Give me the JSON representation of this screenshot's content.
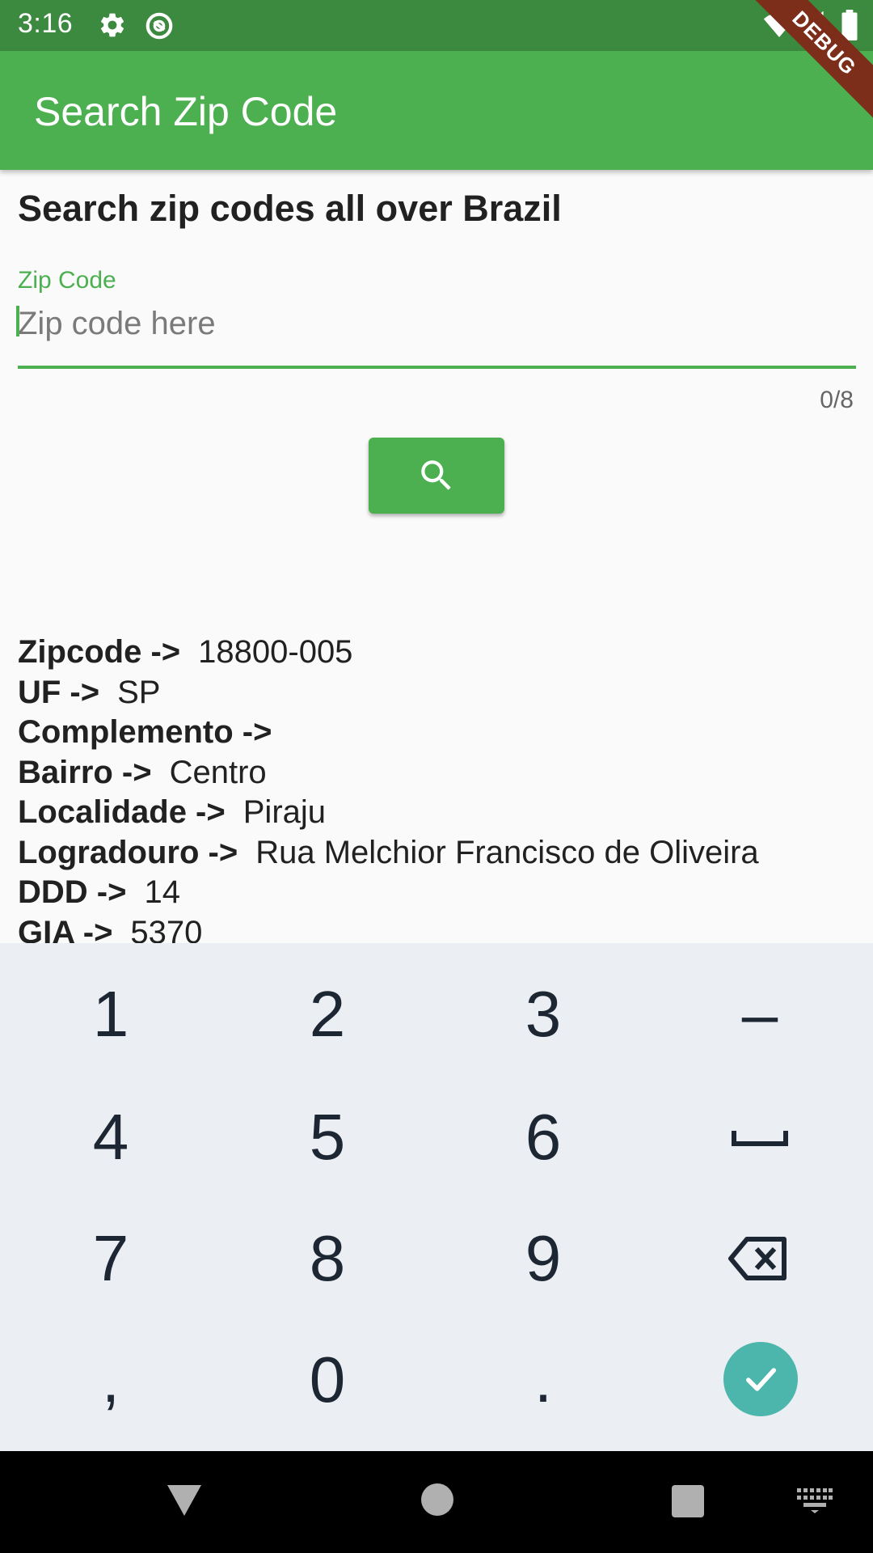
{
  "status_bar": {
    "time": "3:16",
    "icons": [
      "gear-icon",
      "sync-icon",
      "wifi-icon",
      "signal-icon",
      "battery-icon"
    ]
  },
  "debug_banner": "DEBUG",
  "app_bar": {
    "title": "Search Zip Code"
  },
  "content": {
    "headline": "Search zip codes all over Brazil",
    "zip_field": {
      "label": "Zip Code",
      "placeholder": "Zip code here",
      "value": "",
      "counter": "0/8"
    },
    "search_button": {
      "icon": "search-icon"
    }
  },
  "results": [
    {
      "key": "Zipcode ->",
      "value": "18800-005"
    },
    {
      "key": "UF ->",
      "value": "SP"
    },
    {
      "key": "Complemento ->",
      "value": ""
    },
    {
      "key": "Bairro ->",
      "value": "Centro"
    },
    {
      "key": "Localidade ->",
      "value": "Piraju"
    },
    {
      "key": "Logradouro ->",
      "value": "Rua Melchior Francisco de Oliveira"
    },
    {
      "key": "DDD ->",
      "value": "14"
    },
    {
      "key": "GIA ->",
      "value": "5370"
    }
  ],
  "keyboard": {
    "keys": [
      "1",
      "2",
      "3",
      "–",
      "4",
      "5",
      "6",
      "7",
      "8",
      "9",
      ",",
      "0",
      "."
    ],
    "special_keys": [
      "space-icon",
      "backspace-icon",
      "checkmark-icon"
    ]
  },
  "nav_bar": {
    "icons": [
      "back-icon",
      "home-icon",
      "recents-icon",
      "keyboard-icon"
    ]
  },
  "colors": {
    "status_bar": "#3c8a3f",
    "app_bar": "#4caf50",
    "accent": "#4caf50",
    "confirm": "#4db6ac",
    "keyboard_bg": "#ebeef2",
    "debug_ribbon": "#7d2e1b"
  }
}
